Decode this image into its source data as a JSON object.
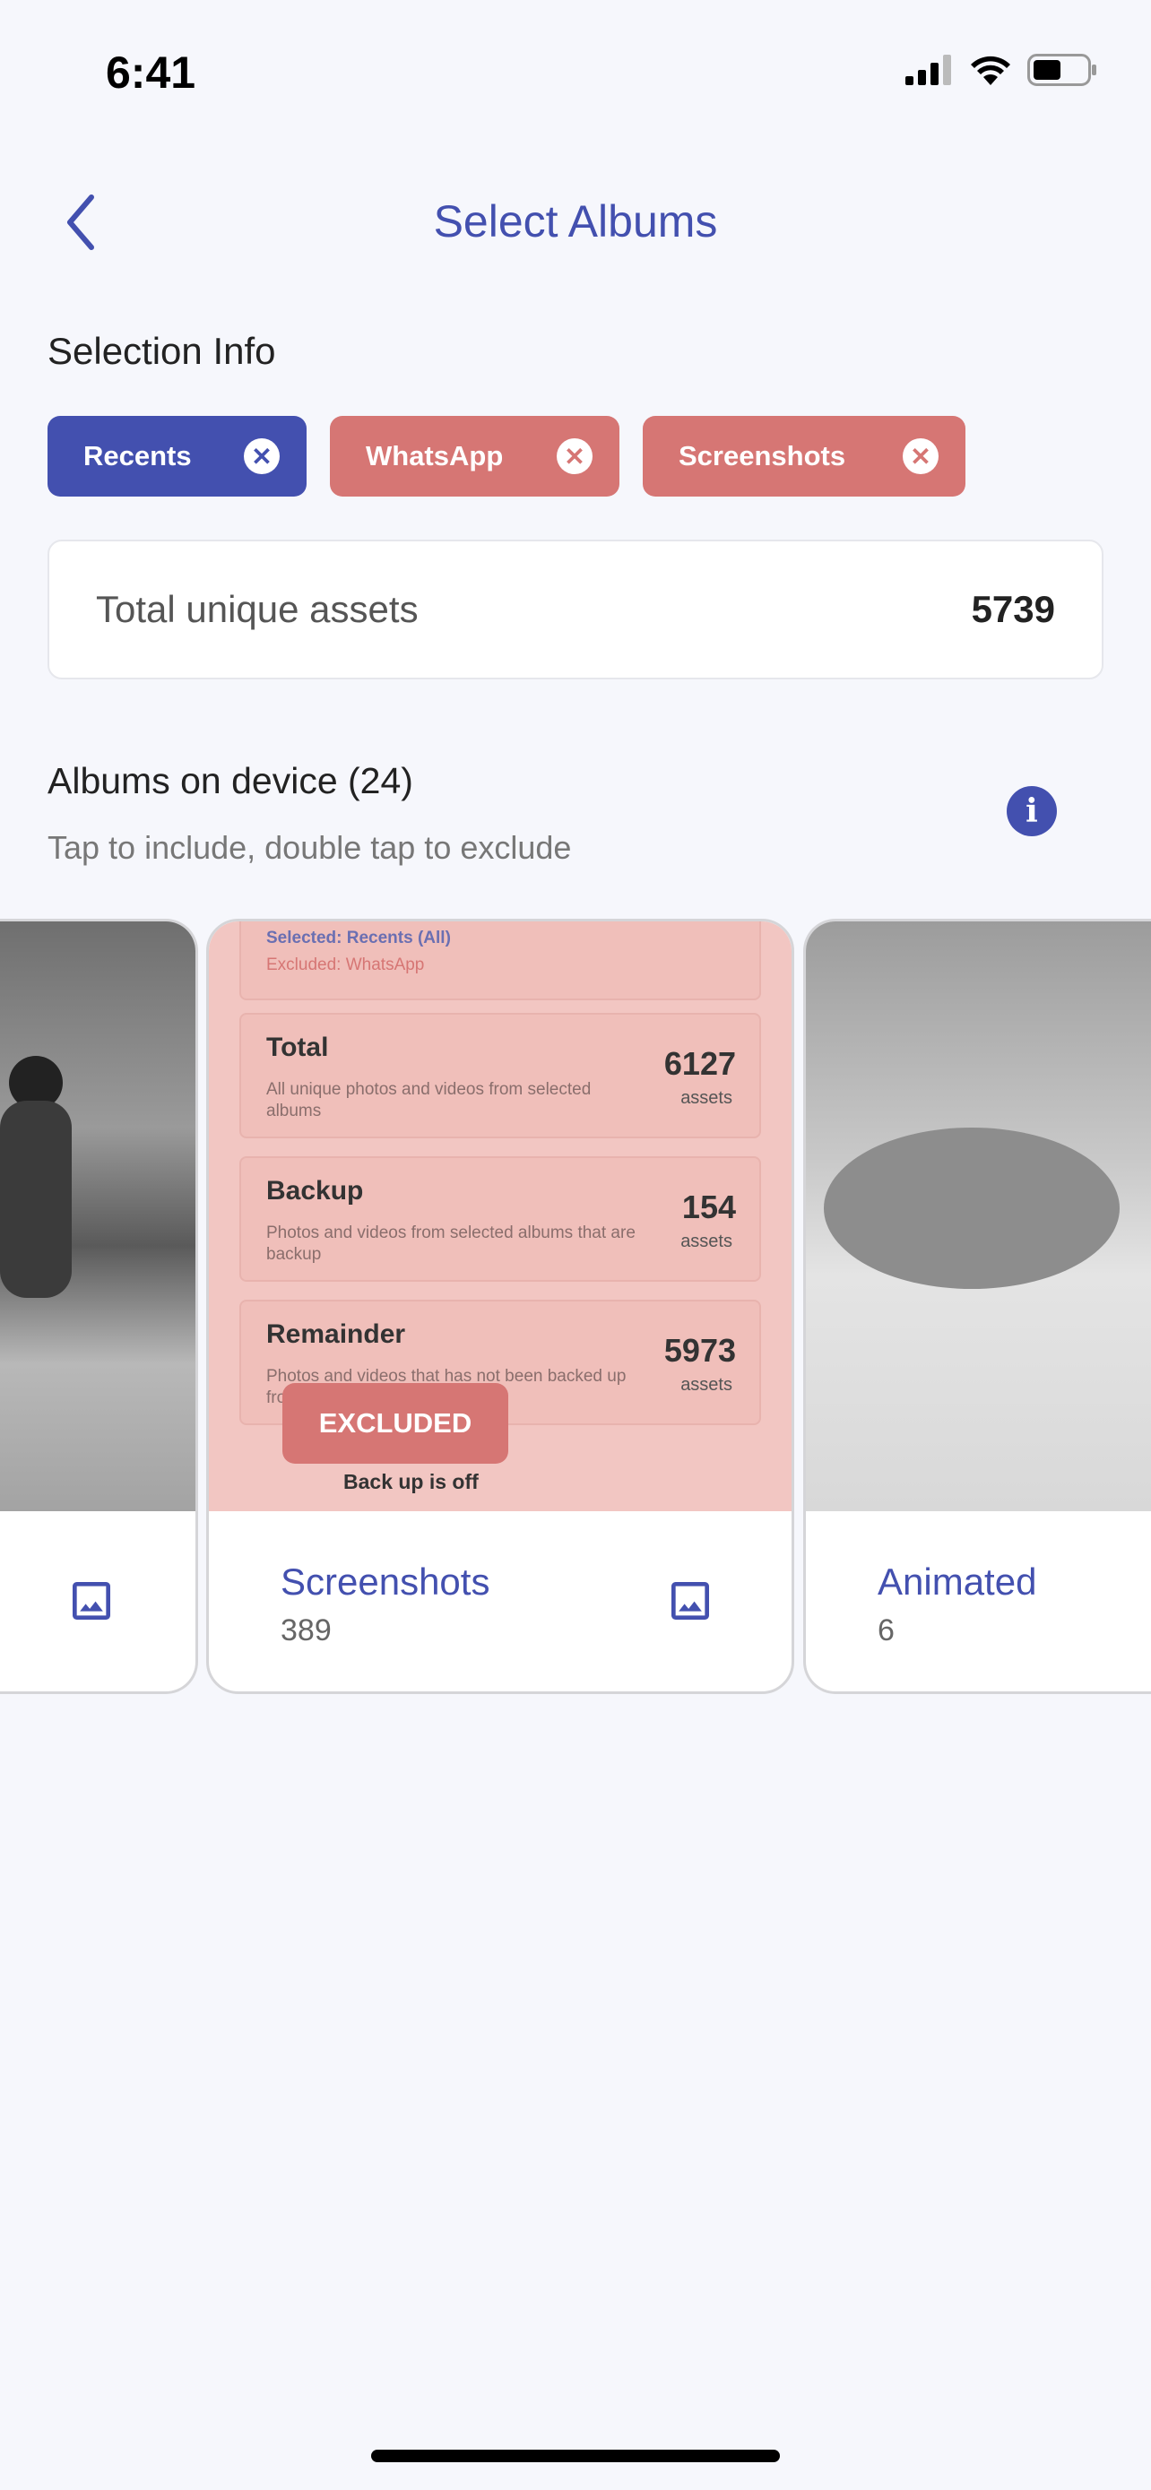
{
  "status": {
    "time": "6:41"
  },
  "header": {
    "title": "Select Albums"
  },
  "selection": {
    "heading": "Selection Info",
    "chips": [
      {
        "label": "Recents",
        "state": "included",
        "color": "#4350af"
      },
      {
        "label": "WhatsApp",
        "state": "excluded",
        "color": "#d67674"
      },
      {
        "label": "Screenshots",
        "state": "excluded",
        "color": "#d67674"
      }
    ]
  },
  "total": {
    "label": "Total unique assets",
    "value": "5739"
  },
  "albums": {
    "heading": "Albums on device (24)",
    "subtitle": "Tap to include, double tap to exclude",
    "items": [
      {
        "name": "",
        "count": ""
      },
      {
        "name": "Screenshots",
        "count": "389",
        "badge": "EXCLUDED",
        "preview": {
          "selected": "Selected: Recents (All)",
          "excluded": "Excluded: WhatsApp",
          "rows": [
            {
              "title": "Total",
              "desc": "All unique photos and videos from selected albums",
              "value": "6127",
              "unit": "assets"
            },
            {
              "title": "Backup",
              "desc": "Photos and videos from selected albums that are backup",
              "value": "154",
              "unit": "assets"
            },
            {
              "title": "Remainder",
              "desc": "Photos and videos that has not been backed up from selected albums",
              "value": "5973",
              "unit": "assets"
            }
          ],
          "footer": "Back up is off"
        }
      },
      {
        "name": "Animated",
        "count": "6"
      }
    ]
  },
  "colors": {
    "accent": "#4350af",
    "excluded": "#d67674",
    "background": "#f6f7fc"
  }
}
